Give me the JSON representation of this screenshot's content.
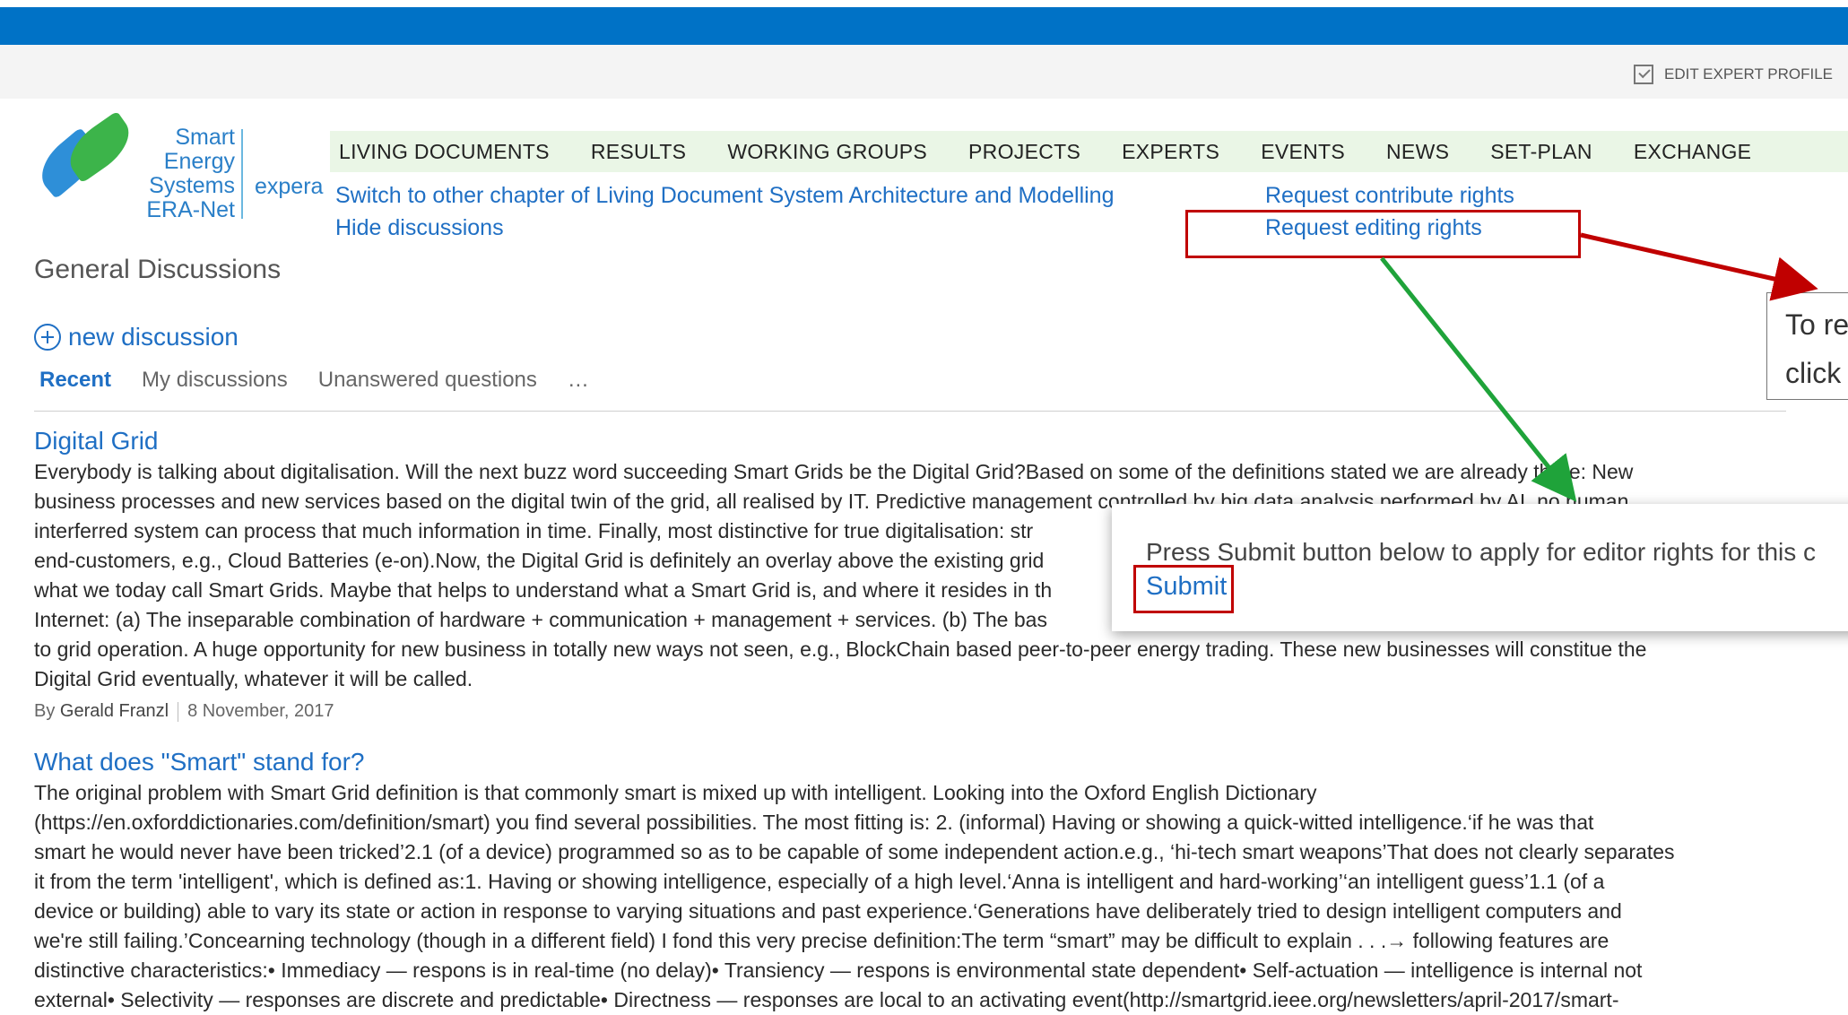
{
  "header": {
    "edit_profile_label": "EDIT EXPERT PROFILE"
  },
  "logo": {
    "line1": "Smart",
    "line2": "Energy",
    "line3": "Systems",
    "line4": "ERA-Net",
    "suffix": "expera"
  },
  "nav": {
    "items": [
      "LIVING DOCUMENTS",
      "RESULTS",
      "WORKING GROUPS",
      "PROJECTS",
      "EXPERTS",
      "EVENTS",
      "NEWS",
      "SET-PLAN",
      "EXCHANGE"
    ]
  },
  "links": {
    "switch_chapter": "Switch to other chapter of Living Document System Architecture and Modelling",
    "hide_discussions": "Hide discussions",
    "request_contribute": "Request contribute rights",
    "request_editing": "Request editing rights"
  },
  "page": {
    "title": "General Discussions",
    "new_discussion": "new discussion",
    "tabs": [
      "Recent",
      "My discussions",
      "Unanswered questions",
      "…"
    ]
  },
  "callout": {
    "line1": "To re",
    "line2": "click"
  },
  "popup": {
    "message": "Press Submit button below to apply for editor rights for this c",
    "submit": "Submit"
  },
  "posts": [
    {
      "title": "Digital Grid",
      "lines": [
        "Everybody is talking about digitalisation. Will the next buzz word succeeding Smart Grids be the Digital Grid?Based on some of the definitions stated we are already there: New",
        "business processes and new services based on the digital twin of the grid, all realised by IT. Predictive management controlled by big data analysis performed by AI, no human",
        "interferred system can process that much information in time. Finally, most distinctive for true digitalisation: str",
        "end-customers, e.g., Cloud Batteries (e-on).Now, the Digital Grid is definitely an overlay above the existing grid",
        "what we today call Smart Grids. Maybe that helps to understand what a Smart Grid is, and where it resides in th",
        "Internet: (a) The inseparable combination of hardware + communication + management + services. (b) The bas",
        "to grid operation. A huge opportunity for new business in totally new ways not seen, e.g., BlockChain based peer-to-peer energy trading. These new businesses will constitue the",
        "Digital Grid eventually, whatever it will be called."
      ],
      "by_label": "By",
      "author": "Gerald Franzl",
      "date": "8 November, 2017"
    },
    {
      "title": "What does \"Smart\" stand for?",
      "lines": [
        "The original problem with Smart Grid definition is that commonly smart is mixed up with intelligent. Looking into the Oxford English Dictionary",
        "(https://en.oxforddictionaries.com/definition/smart) you find several possibilities. The most fitting is: 2. (informal) Having or showing a quick-witted intelligence.‘if he was that",
        "smart he would never have been tricked’2.1 (of a device) programmed so as to be capable of some independent action.e.g., ‘hi-tech smart weapons’That does not clearly separates",
        "it from the term 'intelligent', which is defined as:1. Having or showing intelligence, especially of a high level.‘Anna is intelligent and hard-working’‘an intelligent guess’1.1 (of a",
        "device or building) able to vary its state or action in response to varying situations and past experience.‘Generations have deliberately tried to design intelligent computers and",
        "we're still failing.’Concearning technology (though in a different field) I fond this very precise definition:The term “smart” may be difficult to explain . . .→ following features are",
        "distinctive characteristics:• Immediacy — respons is in real-time (no delay)• Transiency — respons is environmental state dependent• Self-actuation — intelligence is internal not",
        "external• Selectivity — responses are discrete and predictable• Directness — responses are local to an activating event(http://smartgrid.ieee.org/newsletters/april-2017/smart-"
      ]
    }
  ],
  "colors": {
    "topbar": "#0072c6",
    "link": "#1f6fc4",
    "annotation_red": "#c00000",
    "annotation_green": "#1fa33a",
    "nav_bg": "#eaf6e6"
  }
}
